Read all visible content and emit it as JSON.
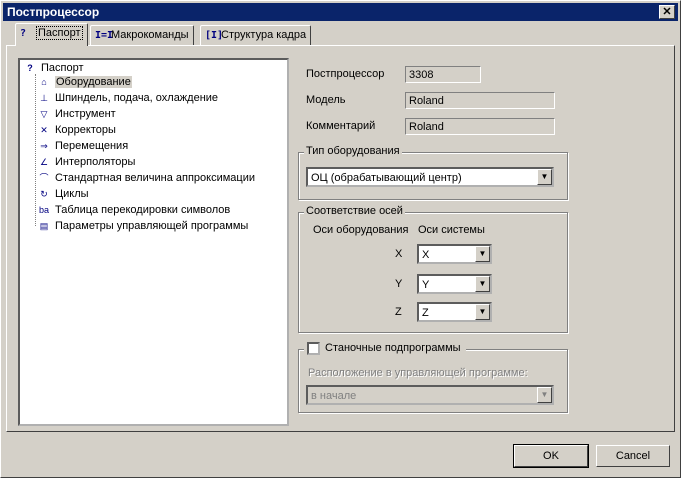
{
  "window": {
    "title": "Постпроцессор",
    "close_glyph": "✕"
  },
  "tabs": [
    {
      "label": "Паспорт",
      "icon": "passport-icon",
      "glyph": "?"
    },
    {
      "label": "Макрокоманды",
      "icon": "macro-icon",
      "glyph": "I=I"
    },
    {
      "label": "Структура кадра",
      "icon": "frame-structure-icon",
      "glyph": "[I]"
    }
  ],
  "tree": {
    "root": "Паспорт",
    "items": [
      {
        "label": "Оборудование",
        "icon": "equipment-icon",
        "glyph": "⌂"
      },
      {
        "label": "Шпиндель, подача, охлаждение",
        "icon": "spindle-icon",
        "glyph": "⊥"
      },
      {
        "label": "Инструмент",
        "icon": "tool-icon",
        "glyph": "▽"
      },
      {
        "label": "Корректоры",
        "icon": "corrector-icon",
        "glyph": "✕"
      },
      {
        "label": "Перемещения",
        "icon": "movement-icon",
        "glyph": "⇒"
      },
      {
        "label": "Интерполяторы",
        "icon": "interpolator-icon",
        "glyph": "∠"
      },
      {
        "label": "Стандартная величина аппроксимации",
        "icon": "approximation-icon",
        "glyph": "⌒"
      },
      {
        "label": "Циклы",
        "icon": "cycles-icon",
        "glyph": "↻"
      },
      {
        "label": "Таблица перекодировки символов",
        "icon": "char-table-icon",
        "glyph": "ba"
      },
      {
        "label": "Параметры управляющей программы",
        "icon": "program-params-icon",
        "glyph": "▤"
      }
    ]
  },
  "form": {
    "postprocessor": {
      "label": "Постпроцессор",
      "value": "3308"
    },
    "model": {
      "label": "Модель",
      "value": "Roland"
    },
    "comment": {
      "label": "Комментарий",
      "value": "Roland"
    },
    "equipment_type": {
      "title": "Тип оборудования",
      "value": "ОЦ (обрабатывающий центр)"
    },
    "axes": {
      "title": "Соответствие осей",
      "col_equipment": "Оси оборудования",
      "col_system": "Оси системы",
      "rows": [
        {
          "axis": "X",
          "value": "X"
        },
        {
          "axis": "Y",
          "value": "Y"
        },
        {
          "axis": "Z",
          "value": "Z"
        }
      ]
    },
    "subprograms": {
      "title": "Станочные подпрограммы",
      "checked": false,
      "location_label": "Расположение в управляющей программе:",
      "location_value": "в начале"
    }
  },
  "buttons": {
    "ok": "OK",
    "cancel": "Cancel"
  },
  "arrow_glyph": "▼"
}
